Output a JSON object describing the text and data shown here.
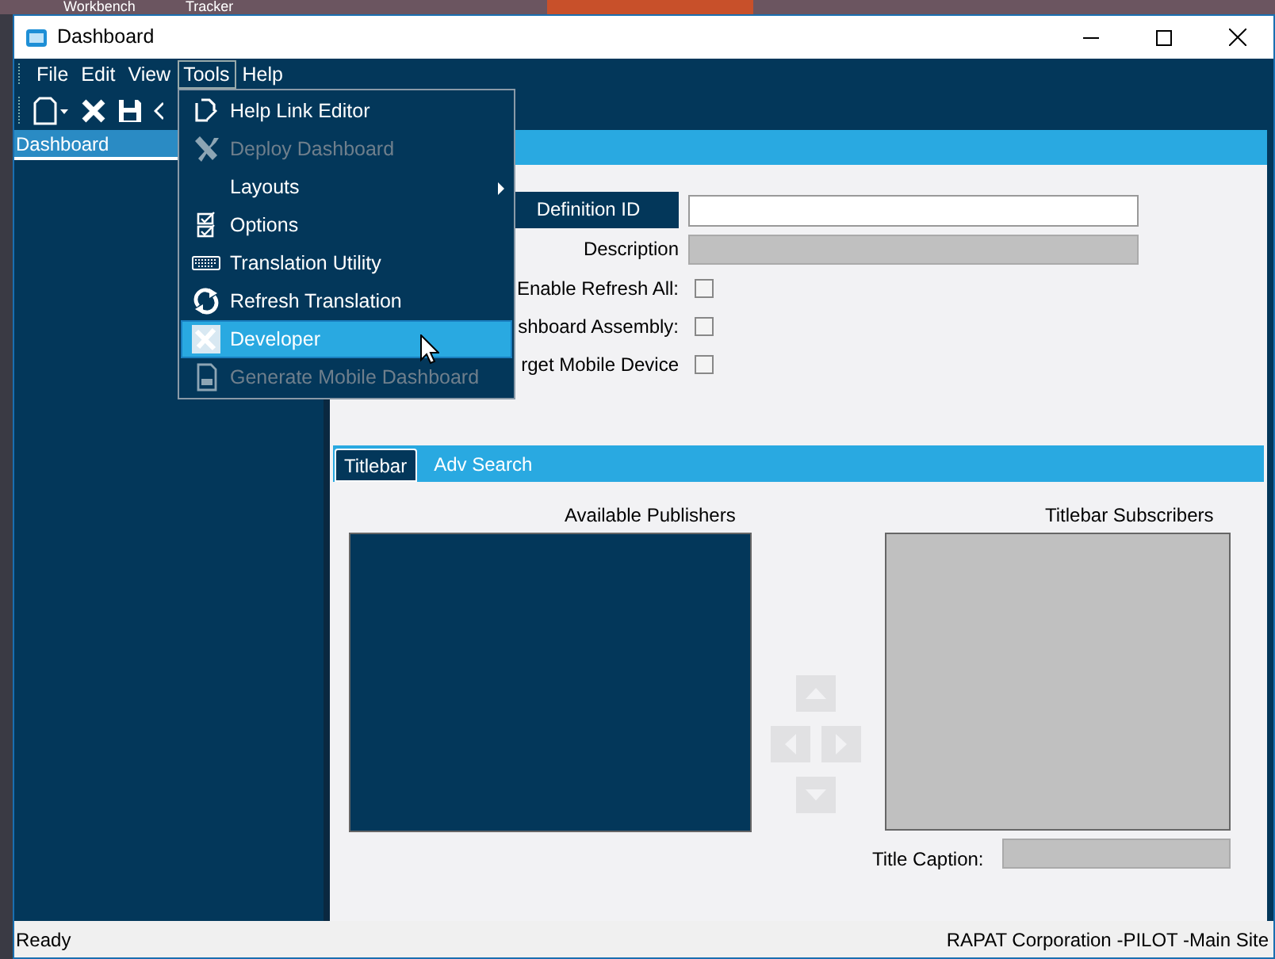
{
  "desktop": {
    "taskbar_items": [
      "Workbench",
      "Tracker"
    ]
  },
  "window": {
    "title": "Dashboard"
  },
  "menu_bar": [
    {
      "label": "File",
      "selected": false
    },
    {
      "label": "Edit",
      "selected": false
    },
    {
      "label": "View",
      "selected": false
    },
    {
      "label": "Tools",
      "selected": true
    },
    {
      "label": "Help",
      "selected": false
    }
  ],
  "tools_menu": [
    {
      "label": "Help Link Editor",
      "disabled": false,
      "highlighted": false,
      "submenu": false
    },
    {
      "label": "Deploy Dashboard",
      "disabled": true,
      "highlighted": false,
      "submenu": false
    },
    {
      "label": "Layouts",
      "disabled": false,
      "highlighted": false,
      "submenu": true
    },
    {
      "label": "Options",
      "disabled": false,
      "highlighted": false,
      "submenu": false
    },
    {
      "label": "Translation Utility",
      "disabled": false,
      "highlighted": false,
      "submenu": false
    },
    {
      "label": "Refresh Translation",
      "disabled": false,
      "highlighted": false,
      "submenu": false
    },
    {
      "label": "Developer",
      "disabled": false,
      "highlighted": true,
      "submenu": false
    },
    {
      "label": "Generate Mobile Dashboard",
      "disabled": true,
      "highlighted": false,
      "submenu": false
    }
  ],
  "left_panel": {
    "title": "Dashboard"
  },
  "form": [
    {
      "kind": "text",
      "label": "Definition ID",
      "focused": true,
      "disabled": false
    },
    {
      "kind": "text",
      "label": "Description",
      "focused": false,
      "disabled": true
    },
    {
      "kind": "checkbox",
      "label": "Enable Refresh All:",
      "checked": false
    },
    {
      "kind": "checkbox",
      "label": "shboard Assembly:",
      "checked": false
    },
    {
      "kind": "checkbox",
      "label": "rget Mobile Device",
      "checked": false
    }
  ],
  "tabs": [
    {
      "label": "Titlebar",
      "selected": true
    },
    {
      "label": "Adv Search",
      "selected": false
    }
  ],
  "publishers": {
    "available_title": "Available Publishers",
    "subscribers_title": "Titlebar Subscribers",
    "caption_label": "Title Caption:"
  },
  "status_bar": {
    "left": "Ready",
    "right": "RAPAT Corporation -PILOT -Main Site"
  }
}
